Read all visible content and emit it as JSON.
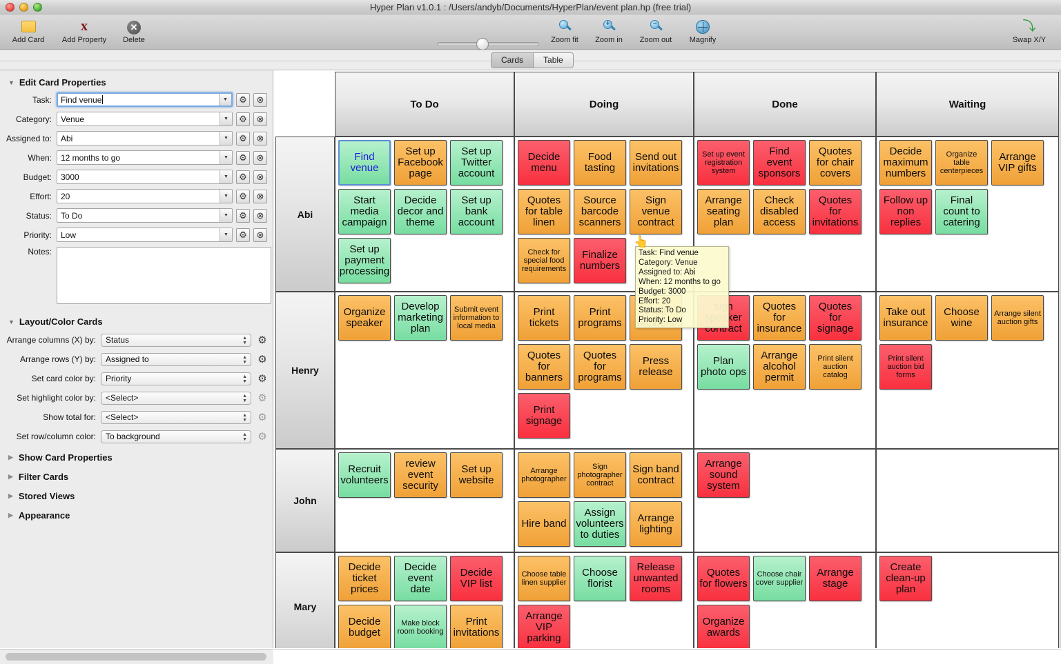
{
  "window": {
    "title": "Hyper Plan v1.0.1 : /Users/andyb/Documents/HyperPlan/event plan.hp (free trial)"
  },
  "toolbar": {
    "add_card": "Add Card",
    "add_property": "Add Property",
    "delete": "Delete",
    "zoom_fit": "Zoom fit",
    "zoom_in": "Zoom in",
    "zoom_out": "Zoom out",
    "magnify": "Magnify",
    "swap": "Swap X/Y",
    "zoom_in_sign": "+",
    "zoom_out_sign": "−",
    "swap_glyph": "⤵"
  },
  "tabs": [
    {
      "label": "Cards",
      "active": true
    },
    {
      "label": "Table",
      "active": false
    }
  ],
  "edit_card_properties": {
    "title": "Edit Card Properties",
    "fields": [
      {
        "label": "Task:",
        "value": "Find venue",
        "focused": true
      },
      {
        "label": "Category:",
        "value": "Venue",
        "focused": false
      },
      {
        "label": "Assigned to:",
        "value": "Abi",
        "focused": false
      },
      {
        "label": "When:",
        "value": "12 months to go",
        "focused": false
      },
      {
        "label": "Budget:",
        "value": "3000",
        "focused": false
      },
      {
        "label": "Effort:",
        "value": "20",
        "focused": false
      },
      {
        "label": "Status:",
        "value": "To Do",
        "focused": false
      },
      {
        "label": "Priority:",
        "value": "Low",
        "focused": false
      }
    ],
    "notes_label": "Notes:",
    "notes_value": ""
  },
  "layout_color_cards": {
    "title": "Layout/Color Cards",
    "rows": [
      {
        "label": "Arrange columns (X) by:",
        "value": "Status",
        "gear_enabled": true
      },
      {
        "label": "Arrange rows (Y) by:",
        "value": "Assigned to",
        "gear_enabled": true
      },
      {
        "label": "Set card color by:",
        "value": "Priority",
        "gear_enabled": true
      },
      {
        "label": "Set highlight color by:",
        "value": "<Select>",
        "gear_enabled": false
      },
      {
        "label": "Show total for:",
        "value": "<Select>",
        "gear_enabled": false
      },
      {
        "label": "Set row/column color:",
        "value": "To background",
        "gear_enabled": false
      }
    ]
  },
  "collapsed_sections": [
    {
      "label": "Show Card Properties"
    },
    {
      "label": "Filter Cards"
    },
    {
      "label": "Stored Views"
    },
    {
      "label": "Appearance"
    }
  ],
  "tooltip": {
    "lines": [
      "Task: Find venue",
      "Category: Venue",
      "Assigned to: Abi",
      "When: 12 months to go",
      "Budget: 3000",
      "Effort: 20",
      "Status: To Do",
      "Priority: Low"
    ]
  },
  "colors": {
    "orange": "#f5ae4a",
    "red": "#fa404e",
    "green": "#8fe3b2",
    "selected_text": "#1b1bdc"
  },
  "board": {
    "columns": [
      "To Do",
      "Doing",
      "Done",
      "Waiting"
    ],
    "rows": [
      "Abi",
      "Henry",
      "John",
      "Mary"
    ],
    "cells": {
      "Abi": {
        "To Do": [
          {
            "label": "Find venue",
            "color": "green",
            "small": false,
            "selected": true
          },
          {
            "label": "Set up Facebook page",
            "color": "orange",
            "small": false
          },
          {
            "label": "Set up Twitter account",
            "color": "green",
            "small": false
          },
          {
            "label": "Start media campaign",
            "color": "green",
            "small": false
          },
          {
            "label": "Decide decor and theme",
            "color": "green",
            "small": false
          },
          {
            "label": "Set up bank account",
            "color": "green",
            "small": false
          },
          {
            "label": "Set up payment processing",
            "color": "green",
            "small": false
          }
        ],
        "Doing": [
          {
            "label": "Decide menu",
            "color": "red",
            "small": false
          },
          {
            "label": "Food tasting",
            "color": "orange",
            "small": false
          },
          {
            "label": "Send out invitations",
            "color": "orange",
            "small": false
          },
          {
            "label": "Quotes for table linen",
            "color": "orange",
            "small": false
          },
          {
            "label": "Source barcode scanners",
            "color": "orange",
            "small": false
          },
          {
            "label": "Sign venue contract",
            "color": "orange",
            "small": false
          },
          {
            "label": "Check for special food requirements",
            "color": "orange",
            "small": true
          },
          {
            "label": "Finalize numbers",
            "color": "red",
            "small": false
          }
        ],
        "Done": [
          {
            "label": "Set up event registration system",
            "color": "red",
            "small": true
          },
          {
            "label": "Find event sponsors",
            "color": "red",
            "small": false
          },
          {
            "label": "Quotes for chair covers",
            "color": "orange",
            "small": false
          },
          {
            "label": "Arrange seating plan",
            "color": "orange",
            "small": false
          },
          {
            "label": "Check disabled access",
            "color": "orange",
            "small": false
          },
          {
            "label": "Quotes for invitations",
            "color": "red",
            "small": false
          }
        ],
        "Waiting": [
          {
            "label": "Decide maximum numbers",
            "color": "orange",
            "small": false
          },
          {
            "label": "Organize table centerpieces",
            "color": "orange",
            "small": true
          },
          {
            "label": "Arrange VIP gifts",
            "color": "orange",
            "small": false
          },
          {
            "label": "Follow up non replies",
            "color": "red",
            "small": false
          },
          {
            "label": "Final count to catering",
            "color": "green",
            "small": false
          }
        ]
      },
      "Henry": {
        "To Do": [
          {
            "label": "Organize speaker",
            "color": "orange",
            "small": false
          },
          {
            "label": "Develop marketing plan",
            "color": "green",
            "small": false
          },
          {
            "label": "Submit event information to local media",
            "color": "orange",
            "small": true
          }
        ],
        "Doing": [
          {
            "label": "Print tickets",
            "color": "orange",
            "small": false
          },
          {
            "label": "Print programs",
            "color": "orange",
            "small": false
          },
          {
            "label": "Print banners",
            "color": "orange",
            "small": false
          },
          {
            "label": "Quotes for banners",
            "color": "orange",
            "small": false
          },
          {
            "label": "Quotes for programs",
            "color": "orange",
            "small": false
          },
          {
            "label": "Press release",
            "color": "orange",
            "small": false
          },
          {
            "label": "Print signage",
            "color": "red",
            "small": false
          }
        ],
        "Done": [
          {
            "label": "sign speaker contract",
            "color": "red",
            "small": false
          },
          {
            "label": "Quotes for insurance",
            "color": "orange",
            "small": false
          },
          {
            "label": "Quotes for signage",
            "color": "red",
            "small": false
          },
          {
            "label": "Plan photo ops",
            "color": "green",
            "small": false
          },
          {
            "label": "Arrange alcohol permit",
            "color": "orange",
            "small": false
          },
          {
            "label": "Print silent auction catalog",
            "color": "orange",
            "small": true
          }
        ],
        "Waiting": [
          {
            "label": "Take out insurance",
            "color": "orange",
            "small": false
          },
          {
            "label": "Choose wine",
            "color": "orange",
            "small": false
          },
          {
            "label": "Arrange silent auction gifts",
            "color": "orange",
            "small": true
          },
          {
            "label": "Print silent auction bid forms",
            "color": "red",
            "small": true
          }
        ]
      },
      "John": {
        "To Do": [
          {
            "label": "Recruit volunteers",
            "color": "green",
            "small": false
          },
          {
            "label": "review event security",
            "color": "orange",
            "small": false
          },
          {
            "label": "Set up website",
            "color": "orange",
            "small": false
          }
        ],
        "Doing": [
          {
            "label": "Arrange photographer",
            "color": "orange",
            "small": true
          },
          {
            "label": "Sign photographer contract",
            "color": "orange",
            "small": true
          },
          {
            "label": "Sign band contract",
            "color": "orange",
            "small": false
          },
          {
            "label": "Hire band",
            "color": "orange",
            "small": false
          },
          {
            "label": "Assign volunteers to duties",
            "color": "green",
            "small": false
          },
          {
            "label": "Arrange lighting",
            "color": "orange",
            "small": false
          }
        ],
        "Done": [
          {
            "label": "Arrange sound system",
            "color": "red",
            "small": false
          }
        ],
        "Waiting": []
      },
      "Mary": {
        "To Do": [
          {
            "label": "Decide ticket prices",
            "color": "orange",
            "small": false
          },
          {
            "label": "Decide event date",
            "color": "green",
            "small": false
          },
          {
            "label": "Decide VIP list",
            "color": "red",
            "small": false
          },
          {
            "label": "Decide budget",
            "color": "orange",
            "small": false
          },
          {
            "label": "Make block room booking",
            "color": "green",
            "small": true
          },
          {
            "label": "Print invitations",
            "color": "orange",
            "small": false
          }
        ],
        "Doing": [
          {
            "label": "Choose table linen supplier",
            "color": "orange",
            "small": true
          },
          {
            "label": "Choose florist",
            "color": "green",
            "small": false
          },
          {
            "label": "Release unwanted rooms",
            "color": "red",
            "small": false
          },
          {
            "label": "Arrange VIP parking",
            "color": "red",
            "small": false
          }
        ],
        "Done": [
          {
            "label": "Quotes for flowers",
            "color": "red",
            "small": false
          },
          {
            "label": "Choose chair cover supplier",
            "color": "green",
            "small": true
          },
          {
            "label": "Arrange stage",
            "color": "red",
            "small": false
          },
          {
            "label": "Organize awards",
            "color": "red",
            "small": false
          }
        ],
        "Waiting": [
          {
            "label": "Create clean-up plan",
            "color": "red",
            "small": false
          }
        ]
      }
    }
  }
}
